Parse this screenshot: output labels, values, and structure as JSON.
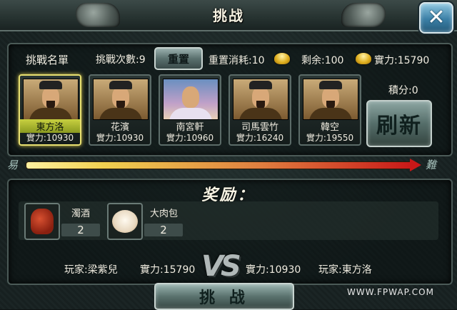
{
  "title": "挑战",
  "close_label": "✕",
  "challenge_list": {
    "heading": "挑戰名單",
    "challenge_count_label": "挑戰次數:9",
    "reset_button": "重置",
    "reset_cost_label": "重置消耗:10",
    "remaining_label": "剩余:100",
    "power_label": "實力:15790",
    "score_label": "積分:0",
    "refresh_button": "刷新"
  },
  "opponents": [
    {
      "name": "東方洛",
      "power": "實力:10930",
      "portrait": "male",
      "selected": true
    },
    {
      "name": "花濱",
      "power": "實力:10930",
      "portrait": "male",
      "selected": false
    },
    {
      "name": "南宮軒",
      "power": "實力:10960",
      "portrait": "female",
      "selected": false
    },
    {
      "name": "司馬雲竹",
      "power": "實力:16240",
      "portrait": "male",
      "selected": false
    },
    {
      "name": "韓空",
      "power": "實力:19550",
      "portrait": "male",
      "selected": false
    }
  ],
  "difficulty": {
    "easy_label": "易",
    "hard_label": "難"
  },
  "reward": {
    "title": "奖励：",
    "items": [
      {
        "name": "濁酒",
        "count": "2",
        "icon": "wine-jar-icon"
      },
      {
        "name": "大肉包",
        "count": "2",
        "icon": "meat-bun-icon"
      }
    ]
  },
  "versus": {
    "player_label": "玩家:梁紫兒",
    "player_power": "實力:15790",
    "vs_label": "VS",
    "opponent_power": "實力:10930",
    "opponent_label": "玩家:東方洛"
  },
  "fight_button": "挑 战",
  "watermark": "WWW.FPWAP.COM",
  "colors": {
    "selected_border": "#e8e070",
    "difficulty_start": "#fff0a0",
    "difficulty_end": "#c81818",
    "button_face": "#5a706e"
  }
}
